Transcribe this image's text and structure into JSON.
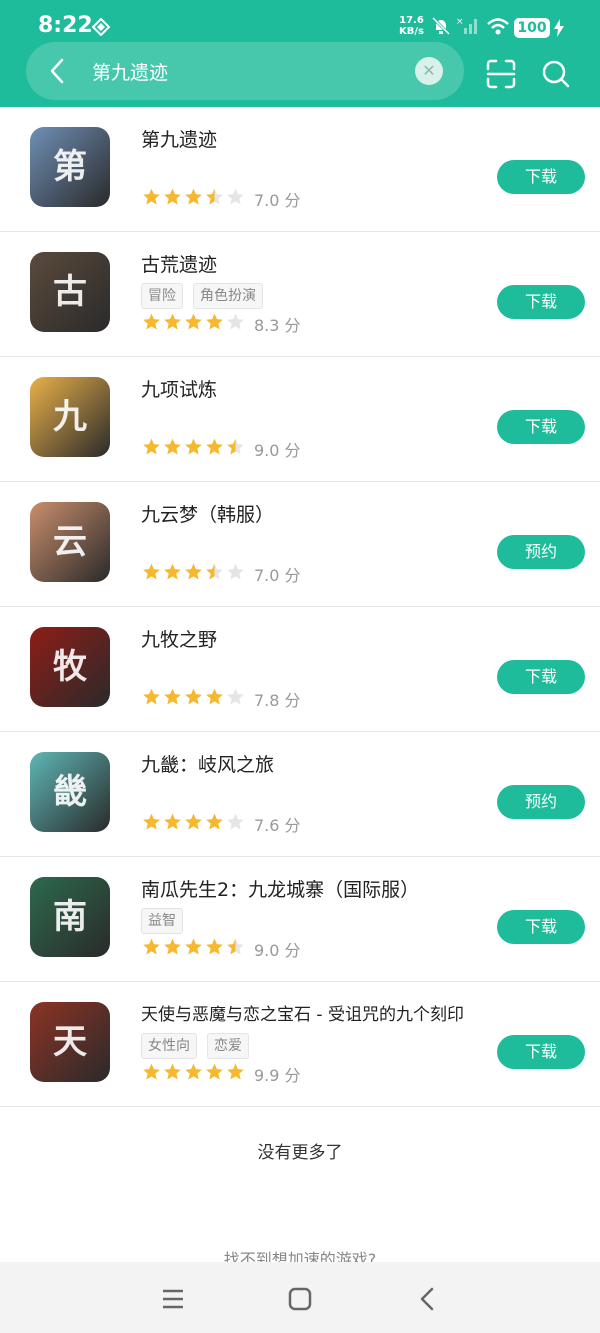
{
  "status_bar": {
    "time": "8:22",
    "net_speed_value": "17.6",
    "net_speed_unit": "KB/s",
    "battery": "100"
  },
  "search": {
    "query": "第九遗迹"
  },
  "results": [
    {
      "name": "第九遗迹",
      "tags": [],
      "rating": 7.0,
      "rating_label": "7.0 分",
      "stars_filled": 3.5,
      "action": "下载",
      "icon_color": "#6f8fb6",
      "icon_glyph": "第"
    },
    {
      "name": "古荒遗迹",
      "tags": [
        "冒险",
        "角色扮演"
      ],
      "rating": 8.3,
      "rating_label": "8.3 分",
      "stars_filled": 4,
      "action": "下载",
      "icon_color": "#5a4a3c",
      "icon_glyph": "古"
    },
    {
      "name": "九项试炼",
      "tags": [],
      "rating": 9.0,
      "rating_label": "9.0 分",
      "stars_filled": 4.5,
      "action": "下载",
      "icon_color": "#e9b04a",
      "icon_glyph": "九"
    },
    {
      "name": "九云梦（韩服）",
      "tags": [],
      "rating": 7.0,
      "rating_label": "7.0 分",
      "stars_filled": 3.5,
      "action": "预约",
      "icon_color": "#c98e6c",
      "icon_glyph": "云"
    },
    {
      "name": "九牧之野",
      "tags": [],
      "rating": 7.8,
      "rating_label": "7.8 分",
      "stars_filled": 4,
      "action": "下载",
      "icon_color": "#8f1d17",
      "icon_glyph": "牧"
    },
    {
      "name": "九畿：岐风之旅",
      "tags": [],
      "rating": 7.6,
      "rating_label": "7.6 分",
      "stars_filled": 4,
      "action": "预约",
      "icon_color": "#5eb7b6",
      "icon_glyph": "畿"
    },
    {
      "name": "南瓜先生2：九龙城寨（国际服）",
      "tags": [
        "益智"
      ],
      "rating": 9.0,
      "rating_label": "9.0 分",
      "stars_filled": 4.5,
      "action": "下载",
      "icon_color": "#2c6a4c",
      "icon_glyph": "南"
    },
    {
      "name": "天使与恶魔与恋之宝石 - 受诅咒的九个刻印",
      "tags": [
        "女性向",
        "恋爱"
      ],
      "rating": 9.9,
      "rating_label": "9.9 分",
      "stars_filled": 5,
      "action": "下载",
      "icon_color": "#8c3325",
      "icon_glyph": "天"
    }
  ],
  "no_more_text": "没有更多了",
  "footer_question": "找不到想加速的游戏?",
  "colors": {
    "accent": "#1fbc9c",
    "star": "#f5b82e",
    "star_empty": "#e5e5e5"
  }
}
